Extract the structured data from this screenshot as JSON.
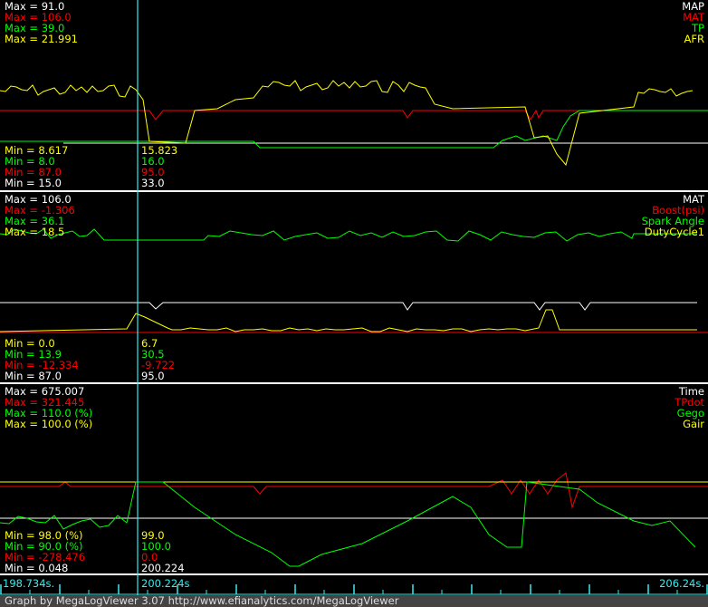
{
  "panels": [
    {
      "max": [
        {
          "label": "Max = 91.0",
          "color": "w"
        },
        {
          "label": "Max = 106.0",
          "color": "red"
        },
        {
          "label": "Max = 39.0",
          "color": "g"
        },
        {
          "label": "Max = 21.991",
          "color": "y"
        }
      ],
      "names": [
        "MAP",
        "MAT",
        "TP",
        "AFR"
      ],
      "min": [
        "Min = 8.617",
        "Min = 8.0",
        "Min = 87.0",
        "Min = 15.0"
      ],
      "cursor": [
        "15.823",
        "16.0",
        "95.0",
        "33.0"
      ]
    },
    {
      "max": [
        {
          "label": "Max = 106.0"
        },
        {
          "label": "Max = -1.306"
        },
        {
          "label": "Max = 36.1"
        },
        {
          "label": "Max = 18.5"
        }
      ],
      "names": [
        "MAT",
        "Boost(psi)",
        "Spark Angle",
        "DutyCycle1"
      ],
      "min": [
        "Min = 0.0",
        "Min = 13.9",
        "Min = -12.334",
        "Min = 87.0"
      ],
      "cursor": [
        "6.7",
        "30.5",
        "-9.722",
        "95.0"
      ]
    },
    {
      "max": [
        {
          "label": "Max = 675.007"
        },
        {
          "label": "Max = 321.445"
        },
        {
          "label": "Max = 110.0 (%)"
        },
        {
          "label": "Max = 100.0 (%)"
        }
      ],
      "names": [
        "Time",
        "TPdot",
        "Gego",
        "Gair"
      ],
      "min": [
        "Min = 98.0 (%)",
        "Min = 90.0 (%)",
        "Min = -278.476",
        "Min = 0.048"
      ],
      "cursor": [
        "99.0",
        "100.0",
        "0.0",
        "200.224"
      ]
    }
  ],
  "axis": {
    "start": "198.734s.",
    "cursor": "200.224s",
    "end": "206.24s."
  },
  "footer": "Graph by MegaLogViewer 3.07 http://www.efianalytics.com/MegaLogViewer",
  "colors": {
    "white": "#ffffff",
    "red": "#ff0000",
    "green": "#00ff00",
    "yellow": "#ffff00",
    "cursor": "#33eeee"
  }
}
